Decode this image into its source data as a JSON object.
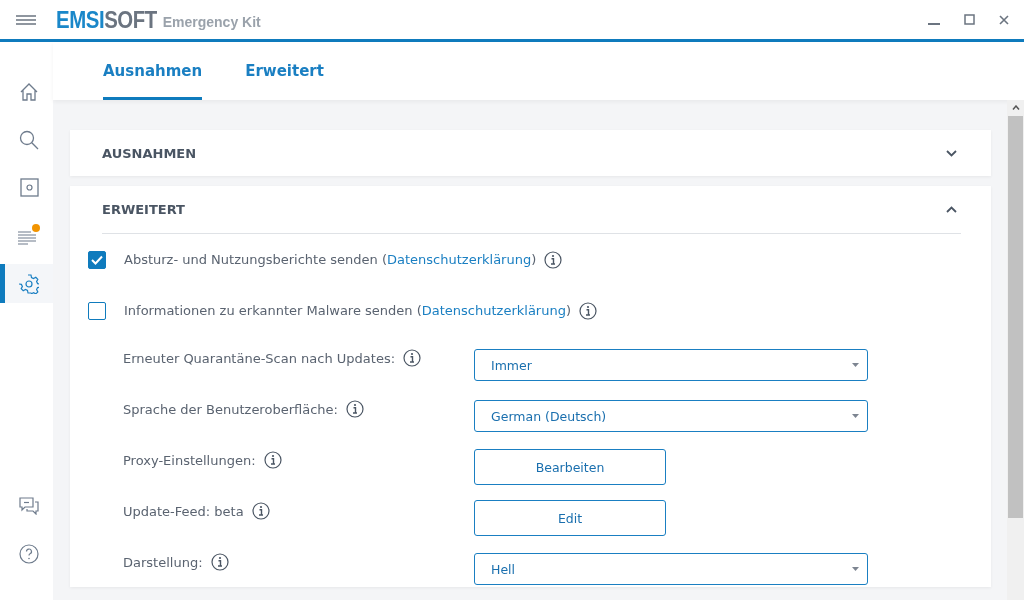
{
  "title_bar": {
    "brand_primary": "EMSI",
    "brand_secondary": "SOFT",
    "product": "Emergency Kit"
  },
  "sidebar": {
    "items": [
      {
        "kind": "home",
        "selected": false,
        "badge": false
      },
      {
        "kind": "search",
        "selected": false,
        "badge": false
      },
      {
        "kind": "scan",
        "selected": false,
        "badge": false
      },
      {
        "kind": "logs",
        "selected": false,
        "badge": true
      },
      {
        "kind": "settings",
        "selected": true,
        "badge": false
      }
    ],
    "bottom_items": [
      {
        "kind": "chat"
      },
      {
        "kind": "help"
      }
    ]
  },
  "tabs": [
    {
      "label": "Ausnahmen",
      "selected": true
    },
    {
      "label": "Erweitert",
      "selected": false
    }
  ],
  "sections": [
    {
      "title": "AUSNAHMEN",
      "expanded": false
    },
    {
      "title": "ERWEITERT",
      "expanded": true,
      "checkboxes": [
        {
          "text": "Absturz- und Nutzungsberichte senden (",
          "link": "Datenschutzerklärung",
          "after": ")",
          "checked": true
        },
        {
          "text": "Informationen zu erkannter Malware senden (",
          "link": "Datenschutzerklärung",
          "after": ")",
          "checked": false
        }
      ],
      "settings": [
        {
          "label": "Erneuter Quarantäne-Scan nach Updates:",
          "kind": "dropdown",
          "value": "Immer"
        },
        {
          "label": "Sprache der Benutzeroberfläche:",
          "kind": "dropdown",
          "value": "German (Deutsch)"
        },
        {
          "label": "Proxy-Einstellungen:",
          "kind": "button",
          "value": "Bearbeiten"
        },
        {
          "label": "Update-Feed: beta",
          "kind": "button",
          "value": "Edit"
        },
        {
          "label": "Darstellung:",
          "kind": "dropdown",
          "value": "Hell"
        }
      ]
    }
  ]
}
